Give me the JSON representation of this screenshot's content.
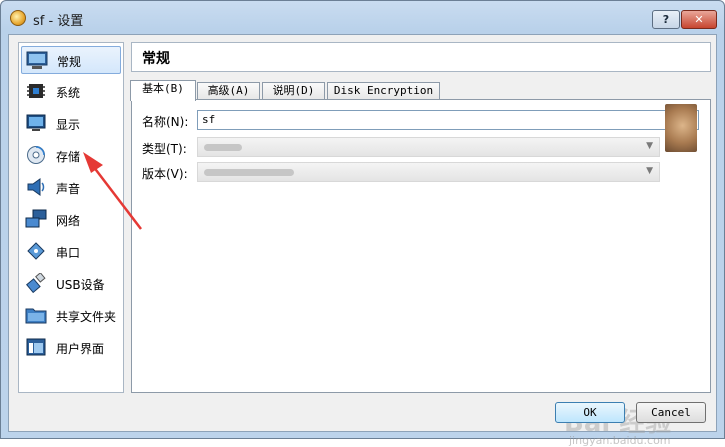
{
  "window": {
    "title": "sf - 设置",
    "help_label": "?",
    "close_label": "✕"
  },
  "sidebar": {
    "items": [
      {
        "label": "常规",
        "icon": "general-icon",
        "selected": true
      },
      {
        "label": "系统",
        "icon": "system-chip-icon",
        "selected": false
      },
      {
        "label": "显示",
        "icon": "display-monitor-icon",
        "selected": false
      },
      {
        "label": "存储",
        "icon": "storage-disk-icon",
        "selected": false
      },
      {
        "label": "声音",
        "icon": "speaker-icon",
        "selected": false
      },
      {
        "label": "网络",
        "icon": "network-icon",
        "selected": false
      },
      {
        "label": "串口",
        "icon": "serial-port-icon",
        "selected": false
      },
      {
        "label": "USB设备",
        "icon": "usb-icon",
        "selected": false
      },
      {
        "label": "共享文件夹",
        "icon": "shared-folder-icon",
        "selected": false
      },
      {
        "label": "用户界面",
        "icon": "user-interface-icon",
        "selected": false
      }
    ]
  },
  "main": {
    "title": "常规",
    "tabs": [
      {
        "label": "基本(B)",
        "active": true
      },
      {
        "label": "高级(A)",
        "active": false
      },
      {
        "label": "说明(D)",
        "active": false
      },
      {
        "label": "Disk Encryption",
        "active": false
      }
    ],
    "fields": {
      "name_label": "名称(N):",
      "name_value": "sf",
      "type_label": "类型(T):",
      "version_label": "版本(V):"
    }
  },
  "footer": {
    "ok_label": "OK",
    "cancel_label": "Cancel"
  },
  "watermark": {
    "text": "Bai 经验",
    "sub": "jingyan.baidu.com"
  },
  "colors": {
    "selection_border": "#84acdd",
    "annotation_arrow": "#e53935"
  }
}
